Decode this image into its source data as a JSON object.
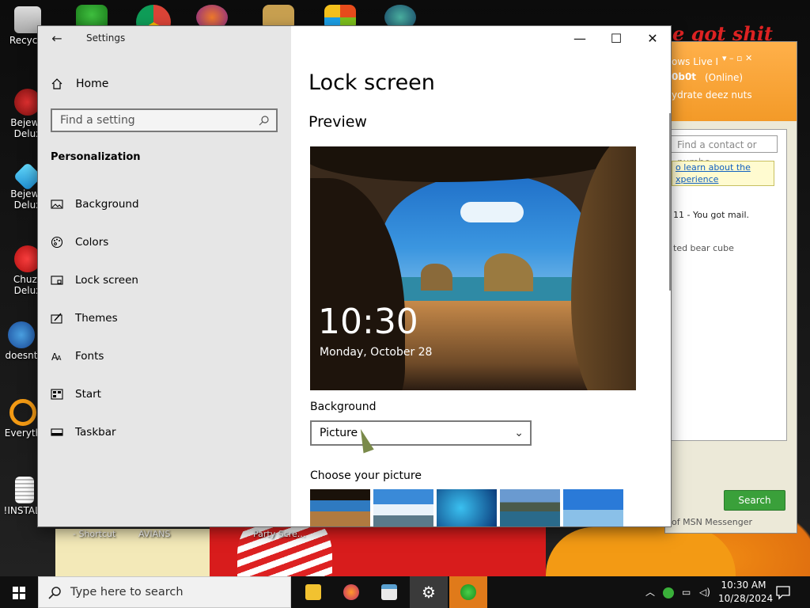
{
  "desktop": {
    "icons": [
      {
        "label": "Recycle",
        "name": "recycle-bin-icon"
      },
      {
        "label": "Bejewe Delux",
        "name": "bejeweled-deluxe-icon"
      },
      {
        "label": "Bejewe Delux",
        "name": "bejeweled-deluxe-2-icon"
      },
      {
        "label": "Chuzz Delux",
        "name": "chuzzle-deluxe-icon"
      },
      {
        "label": "doesnt",
        "name": "doesnt-icon"
      },
      {
        "label": "Everyth",
        "name": "everything-icon"
      },
      {
        "label": "!INSTALL",
        "name": "install-icon"
      }
    ],
    "bottom_labels": [
      "- Shortcut",
      "AVIANS",
      "Party Scre..."
    ],
    "wallpaper_text": "e got shit"
  },
  "messenger": {
    "title": "ows Live I",
    "user": "0b0t",
    "status": "(Online)",
    "message": "ydrate deez nuts",
    "find_placeholder": "Find a contact or numbe",
    "info_link": "o learn about the xperience",
    "mail": "11 - You got mail.",
    "contact": "ted bear cube",
    "search_button": "Search",
    "footer": "of MSN Messenger"
  },
  "settings": {
    "window_title": "Settings",
    "home_label": "Home",
    "search_placeholder": "Find a setting",
    "section_title": "Personalization",
    "nav": [
      {
        "label": "Background",
        "icon": "picture-icon"
      },
      {
        "label": "Colors",
        "icon": "palette-icon"
      },
      {
        "label": "Lock screen",
        "icon": "lock-screen-icon"
      },
      {
        "label": "Themes",
        "icon": "brush-icon"
      },
      {
        "label": "Fonts",
        "icon": "font-icon"
      },
      {
        "label": "Start",
        "icon": "start-icon"
      },
      {
        "label": "Taskbar",
        "icon": "taskbar-icon"
      }
    ],
    "page_title": "Lock screen",
    "preview_heading": "Preview",
    "preview_time": "10:30",
    "preview_date": "Monday, October 28",
    "background_label": "Background",
    "background_value": "Picture",
    "choose_label": "Choose your picture"
  },
  "taskbar": {
    "search_placeholder": "Type here to search",
    "time": "10:30 AM",
    "date": "10/28/2024",
    "apps": [
      "file-explorer-icon",
      "firefox-icon",
      "notepad-icon",
      "settings-icon",
      "msn-messenger-icon"
    ]
  }
}
